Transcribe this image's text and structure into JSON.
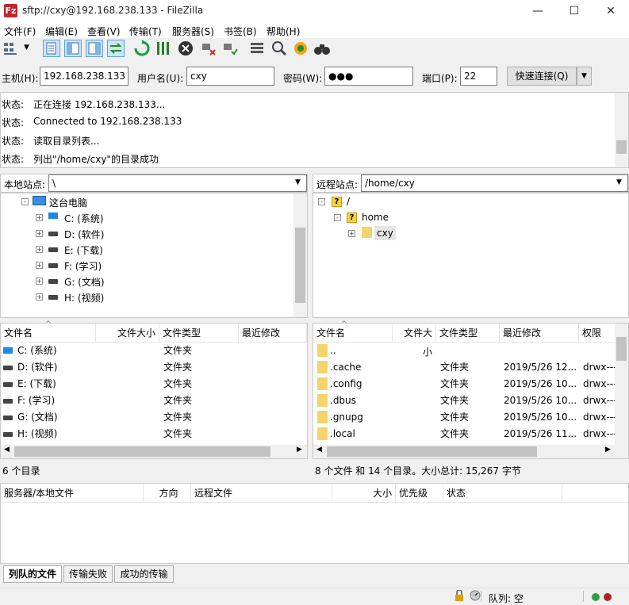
{
  "window": {
    "title": "sftp://cxy@192.168.238.133 - FileZilla",
    "app_icon": "Fz"
  },
  "menu": [
    {
      "label": "文件(F)"
    },
    {
      "label": "编辑(E)"
    },
    {
      "label": "查看(V)"
    },
    {
      "label": "传输(T)"
    },
    {
      "label": "服务器(S)"
    },
    {
      "label": "书签(B)"
    },
    {
      "label": "帮助(H)"
    }
  ],
  "connect": {
    "host_label": "主机(H):",
    "host": "192.168.238.133",
    "user_label": "用户名(U):",
    "user": "cxy",
    "pass_label": "密码(W):",
    "pass": "●●●",
    "port_label": "端口(P):",
    "port": "22",
    "quick_label": "快速连接(Q)"
  },
  "log": [
    {
      "label": "状态:",
      "text": "正在连接 192.168.238.133..."
    },
    {
      "label": "状态:",
      "text": "Connected to 192.168.238.133"
    },
    {
      "label": "状态:",
      "text": "读取目录列表..."
    },
    {
      "label": "状态:",
      "text": "列出\"/home/cxy\"的目录成功"
    }
  ],
  "local": {
    "site_label": "本地站点:",
    "path": "\\",
    "tree_root": "这台电脑",
    "drives": [
      "C: (系统)",
      "D: (软件)",
      "E: (下载)",
      "F: (学习)",
      "G: (文档)",
      "H: (视频)"
    ],
    "columns": [
      "文件名",
      "文件大小",
      "文件类型",
      "最近修改"
    ],
    "rows": [
      {
        "name": "C: (系统)",
        "type": "文件夹"
      },
      {
        "name": "D: (软件)",
        "type": "文件夹"
      },
      {
        "name": "E: (下载)",
        "type": "文件夹"
      },
      {
        "name": "F: (学习)",
        "type": "文件夹"
      },
      {
        "name": "G: (文档)",
        "type": "文件夹"
      },
      {
        "name": "H: (视频)",
        "type": "文件夹"
      }
    ],
    "summary": "6 个目录"
  },
  "remote": {
    "site_label": "远程站点:",
    "path": "/home/cxy",
    "tree": [
      "/",
      "home",
      "cxy"
    ],
    "columns": [
      "文件名",
      "文件大小",
      "文件类型",
      "最近修改",
      "权限"
    ],
    "rows": [
      {
        "name": "..",
        "type": "",
        "modified": "",
        "perm": ""
      },
      {
        "name": ".cache",
        "type": "文件夹",
        "modified": "2019/5/26 12...",
        "perm": "drwx---"
      },
      {
        "name": ".config",
        "type": "文件夹",
        "modified": "2019/5/26 10...",
        "perm": "drwx---"
      },
      {
        "name": ".dbus",
        "type": "文件夹",
        "modified": "2019/5/26 10...",
        "perm": "drwx---"
      },
      {
        "name": ".gnupg",
        "type": "文件夹",
        "modified": "2019/5/26 10...",
        "perm": "drwx---"
      },
      {
        "name": ".local",
        "type": "文件夹",
        "modified": "2019/5/26 11...",
        "perm": "drwx---"
      }
    ],
    "summary": "8 个文件 和 14 个目录。大小总计: 15,267 字节"
  },
  "queue": {
    "columns": [
      "服务器/本地文件",
      "方向",
      "远程文件",
      "大小",
      "优先级",
      "状态"
    ],
    "tabs": [
      "列队的文件",
      "传输失败",
      "成功的传输"
    ],
    "status": "队列: 空"
  }
}
